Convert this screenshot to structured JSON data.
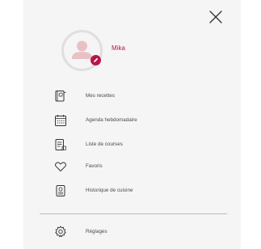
{
  "profile": {
    "name": "Mika"
  },
  "menu": {
    "items": [
      {
        "label": "Mes recettes",
        "icon": "recipe-book-icon"
      },
      {
        "label": "Agenda hebdomadaire",
        "icon": "calendar-icon"
      },
      {
        "label": "Liste de courses",
        "icon": "shopping-list-icon"
      },
      {
        "label": "Favoris",
        "icon": "heart-icon"
      },
      {
        "label": "Historique de cuisine",
        "icon": "cooking-history-icon"
      }
    ],
    "settings": {
      "label": "Réglages",
      "icon": "gear-icon"
    }
  },
  "colors": {
    "accent": "#b8154c",
    "avatar": "#e9c0c4",
    "drawer_bg": "#f6f5f5",
    "text": "#4a4a4a"
  }
}
